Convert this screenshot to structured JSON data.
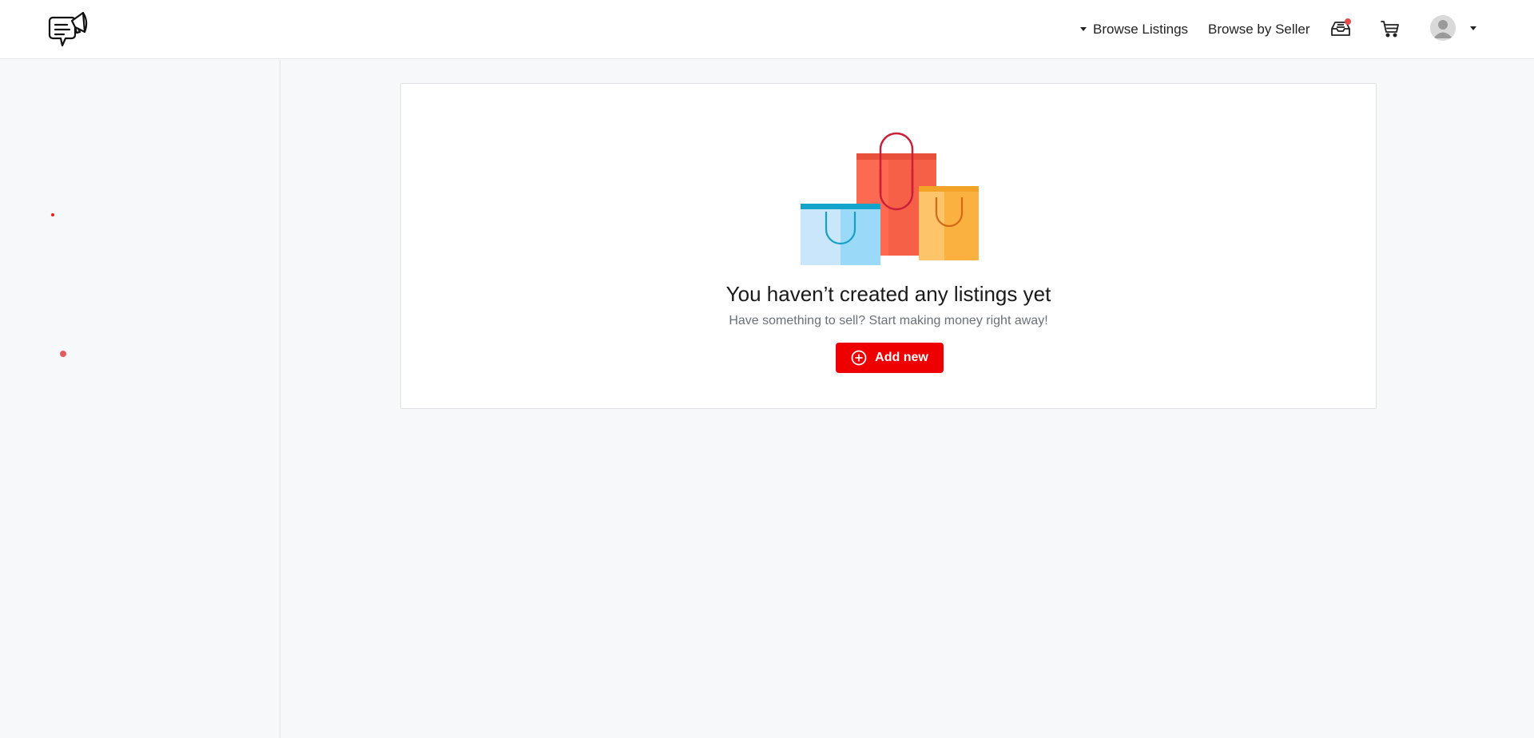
{
  "header": {
    "nav": {
      "browse_listings": "Browse Listings",
      "browse_by_seller": "Browse by Seller"
    },
    "icons": {
      "logo": "megaphone-chat-logo",
      "inbox": "inbox-icon",
      "cart": "cart-icon",
      "avatar": "user-avatar",
      "dropdown": "chevron-down-icon"
    },
    "inbox_has_notification": true
  },
  "empty_state": {
    "illustration": "shopping-bags",
    "title": "You haven’t created any listings yet",
    "subtitle": "Have something to sell? Start making money right away!",
    "add_button": "Add new"
  },
  "colors": {
    "accent": "#ee0000",
    "notification_dot": "#e74c4c",
    "background": "#f7f8fa"
  }
}
